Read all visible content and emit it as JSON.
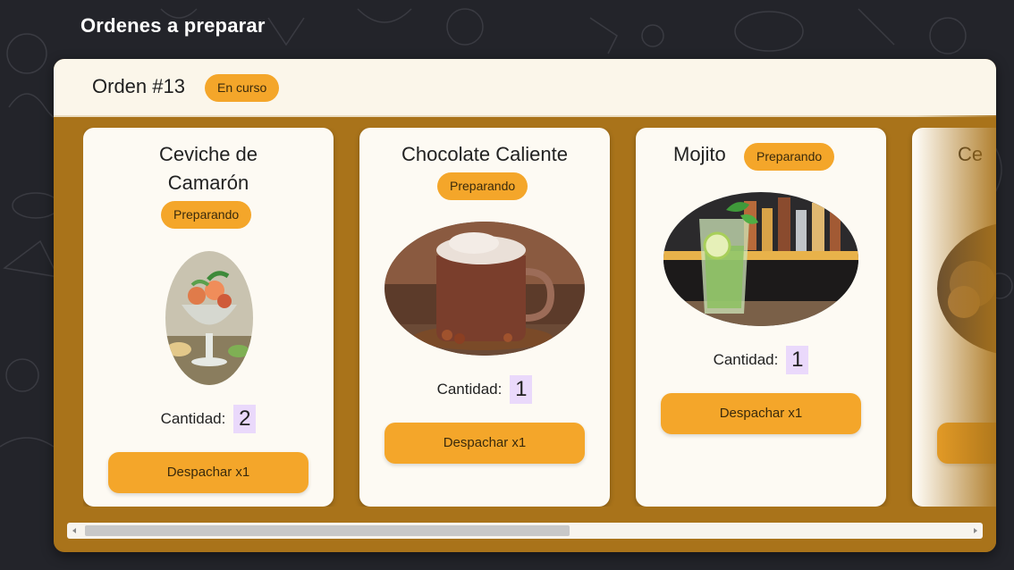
{
  "page": {
    "title": "Ordenes a preparar"
  },
  "order": {
    "title": "Orden #13",
    "status": "En curso"
  },
  "cards": [
    {
      "name_line1": "Ceviche de",
      "name_line2": "Camarón",
      "status": "Preparando",
      "quantity_label": "Cantidad:",
      "quantity": "2",
      "button": "Despachar x1",
      "icon": "ceviche-glass-image"
    },
    {
      "name": "Chocolate Caliente",
      "status": "Preparando",
      "quantity_label": "Cantidad:",
      "quantity": "1",
      "button": "Despachar x1",
      "icon": "hot-chocolate-mug-image"
    },
    {
      "name": "Mojito",
      "status": "Preparando",
      "quantity_label": "Cantidad:",
      "quantity": "1",
      "button": "Despachar x1",
      "icon": "mojito-glass-image"
    },
    {
      "name": "Ce",
      "icon": "ceviche-plate-image"
    }
  ],
  "scroll": {
    "horizontal_position": 0.0,
    "visible_fraction": 0.53
  },
  "colors": {
    "background": "#23242a",
    "panel": "#a9731a",
    "header": "#fbf6ea",
    "card": "#fdfaf3",
    "accent": "#f4a62a",
    "quantity_highlight": "#ead9fb"
  }
}
